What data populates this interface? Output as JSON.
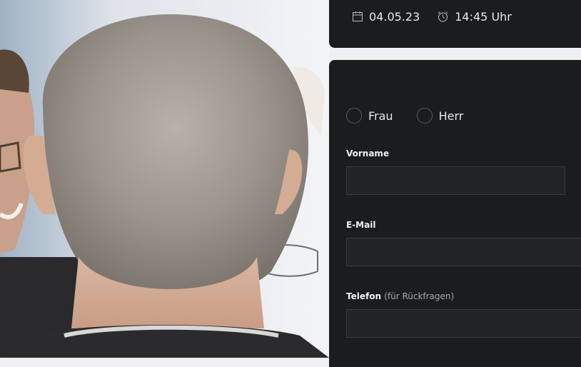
{
  "booking_summary": {
    "date": "04.05.23",
    "time": "14:45 Uhr",
    "date_icon": "calendar-icon",
    "time_icon": "alarm-clock-icon"
  },
  "form": {
    "salutation": {
      "options": [
        "Frau",
        "Herr"
      ],
      "selected": null
    },
    "first_name": {
      "label": "Vorname",
      "value": ""
    },
    "email": {
      "label": "E-Mail",
      "value": ""
    },
    "phone": {
      "label": "Telefon",
      "hint": "(für Rückfragen)",
      "value": ""
    }
  },
  "colors": {
    "card_background": "#1b1c1e",
    "input_background": "#222325",
    "input_border": "#3a3b3e",
    "text_primary": "#e9e9ea",
    "text_muted": "#a8a9ac"
  }
}
